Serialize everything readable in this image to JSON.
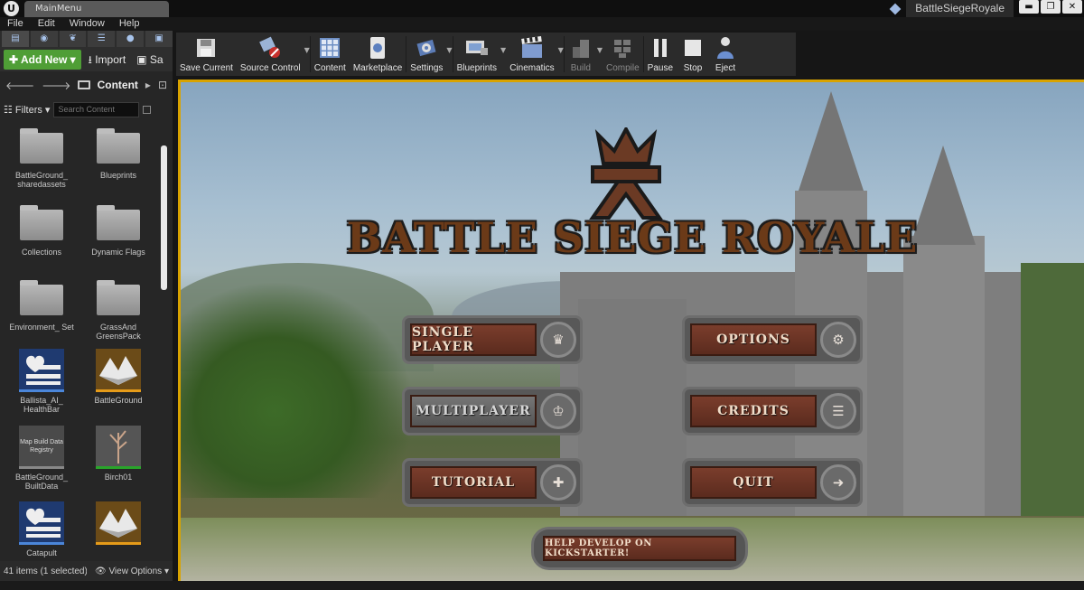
{
  "window": {
    "tab_title": "MainMenu",
    "project_name": "BattleSiegeRoyale",
    "minimize": "▬",
    "maximize": "❐",
    "close": "✕"
  },
  "menu": [
    "File",
    "Edit",
    "Window",
    "Help"
  ],
  "content_browser": {
    "add_new": "Add New",
    "import": "Import",
    "save_partial": "Sa",
    "path": "Content",
    "filters": "Filters",
    "search_placeholder": "Search Content",
    "assets": [
      {
        "label": "BattleGround_ sharedassets",
        "kind": "folder"
      },
      {
        "label": "Blueprints",
        "kind": "folder"
      },
      {
        "label": "Collections",
        "kind": "folder"
      },
      {
        "label": "Dynamic Flags",
        "kind": "folder"
      },
      {
        "label": "Environment_ Set",
        "kind": "folder"
      },
      {
        "label": "GrassAnd GreensPack",
        "kind": "folder"
      },
      {
        "label": "Ballista_AI_ HealthBar",
        "kind": "widget-blueprint"
      },
      {
        "label": "BattleGround",
        "kind": "level"
      },
      {
        "label": "BattleGround_ BuiltData",
        "kind": "map-build-data",
        "thumb_text": "Map Build Data Registry"
      },
      {
        "label": "Birch01",
        "kind": "static-mesh"
      },
      {
        "label": "Catapult",
        "kind": "widget-blueprint"
      },
      {
        "label": "",
        "kind": "level"
      }
    ],
    "status": "41 items (1 selected)",
    "view_options": "View Options"
  },
  "toolbar": [
    {
      "label": "Save Current",
      "icon": "save-icon",
      "enabled": true,
      "caret": false
    },
    {
      "label": "Source Control",
      "icon": "source-control-icon",
      "enabled": true,
      "caret": true
    },
    {
      "label": "Content",
      "icon": "content-icon",
      "enabled": true,
      "caret": false
    },
    {
      "label": "Marketplace",
      "icon": "marketplace-icon",
      "enabled": true,
      "caret": false
    },
    {
      "label": "Settings",
      "icon": "settings-icon",
      "enabled": true,
      "caret": true
    },
    {
      "label": "Blueprints",
      "icon": "blueprints-icon",
      "enabled": true,
      "caret": true
    },
    {
      "label": "Cinematics",
      "icon": "cinematics-icon",
      "enabled": true,
      "caret": true
    },
    {
      "label": "Build",
      "icon": "build-icon",
      "enabled": false,
      "caret": true
    },
    {
      "label": "Compile",
      "icon": "compile-icon",
      "enabled": false,
      "caret": false
    },
    {
      "label": "Pause",
      "icon": "pause-icon",
      "enabled": true,
      "caret": false
    },
    {
      "label": "Stop",
      "icon": "stop-icon",
      "enabled": true,
      "caret": false
    },
    {
      "label": "Eject",
      "icon": "eject-icon",
      "enabled": true,
      "caret": false
    }
  ],
  "game": {
    "title": "BATTLE SIEGE ROYALE",
    "buttons": {
      "single_player": "SINGLE PLAYER",
      "options": "OPTIONS",
      "multi_player": "MULTIPLAYER",
      "credits": "CREDITS",
      "tutorial": "TUTORIAL",
      "quit": "QUIT",
      "kickstarter": "HELP DEVELOP ON KICKSTARTER!"
    }
  },
  "colors": {
    "add_new_green": "#4f9e36",
    "viewport_border": "#d9a300",
    "plank_brown": "#6b3a24"
  }
}
